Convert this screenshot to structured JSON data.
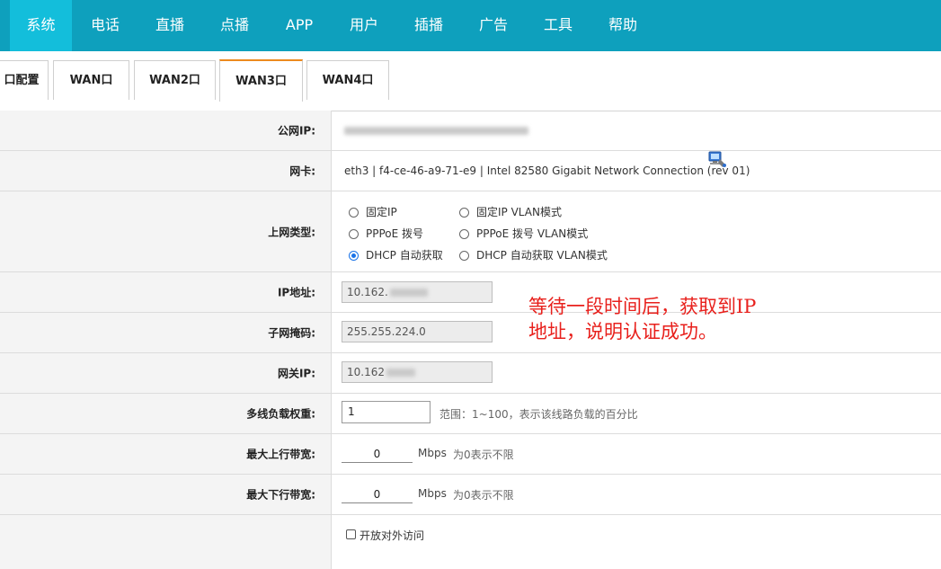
{
  "nav": {
    "items": [
      "系统",
      "电话",
      "直播",
      "点播",
      "APP",
      "用户",
      "插播",
      "广告",
      "工具",
      "帮助"
    ],
    "active": "系统"
  },
  "tabs": {
    "items": [
      "口配置",
      "WAN口",
      "WAN2口",
      "WAN3口",
      "WAN4口"
    ],
    "active": "WAN3口"
  },
  "form": {
    "public_ip": {
      "label": "公网IP:"
    },
    "nic": {
      "label": "网卡:",
      "value": "eth3 | f4-ce-46-a9-71-e9 | Intel 82580 Gigabit Network Connection (rev 01)",
      "icon": "network-card-icon"
    },
    "conn_type": {
      "label": "上网类型:",
      "options": [
        "固定IP",
        "固定IP VLAN模式",
        "PPPoE 拨号",
        "PPPoE 拨号 VLAN模式",
        "DHCP 自动获取",
        "DHCP 自动获取 VLAN模式"
      ],
      "selected": "DHCP 自动获取"
    },
    "ip": {
      "label": "IP地址:",
      "value": "10.162."
    },
    "mask": {
      "label": "子网掩码:",
      "value": "255.255.224.0"
    },
    "gateway": {
      "label": "网关IP:",
      "value": "10.162"
    },
    "weight": {
      "label": "多线负载权重:",
      "value": "1",
      "hint": "范围：1~100，表示该线路负载的百分比"
    },
    "up_bw": {
      "label": "最大上行带宽:",
      "value": "0",
      "unit": "Mbps",
      "hint": "为0表示不限"
    },
    "down_bw": {
      "label": "最大下行带宽:",
      "value": "0",
      "unit": "Mbps",
      "hint": "为0表示不限"
    },
    "external_access": {
      "label": "开放对外访问",
      "checked": false
    }
  },
  "annotation": {
    "line1": "等待一段时间后，获取到IP",
    "line2": "地址，说明认证成功。"
  }
}
